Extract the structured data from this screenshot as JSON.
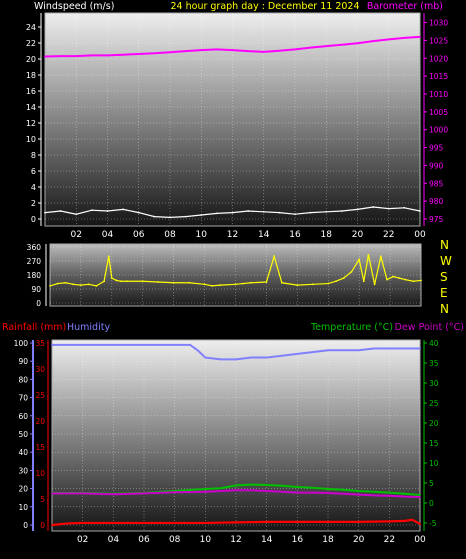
{
  "header": {
    "left_label": "Windspeed (m/s)",
    "title": "24 hour graph day : December 11 2024",
    "right_label": "Barometer (mb)"
  },
  "colors": {
    "background": "#000000",
    "windspeed": "#ffffff",
    "barometer": "#ff00ff",
    "direction": "#ffff00",
    "rainfall": "#ff0000",
    "humidity": "#8080ff",
    "temperature": "#00c000",
    "dewpoint": "#cc00cc",
    "grid": "#ffffff",
    "axis_left_wind": "#ffffff",
    "axis_right_baro": "#ff00ff",
    "axis_rain": "#ff0000",
    "axis_humidity": "#8080ff",
    "axis_temp": "#00c000"
  },
  "x_ticks": [
    "02",
    "04",
    "06",
    "08",
    "10",
    "12",
    "14",
    "16",
    "18",
    "20",
    "22",
    "00"
  ],
  "compass": [
    "N",
    "W",
    "S",
    "E",
    "N"
  ],
  "bottom_header": {
    "rain_label": "Rainfall (mm)",
    "humidity_label": "Humidity",
    "temp_label": "Temperature (°C)",
    "dew_label": "Dew Point (°C)"
  },
  "chart_data": [
    {
      "type": "line",
      "name": "wind-baro",
      "title": "24 hour graph day : December 11 2024",
      "xlabel": "",
      "ylabel": "Windspeed (m/s)",
      "y2label": "Barometer (mb)",
      "x_ticks": [
        "02",
        "04",
        "06",
        "08",
        "10",
        "12",
        "14",
        "16",
        "18",
        "20",
        "22",
        "00"
      ],
      "ylim": [
        0,
        25
      ],
      "y_ticks": [
        0,
        2,
        4,
        6,
        8,
        10,
        12,
        14,
        16,
        18,
        20,
        22,
        24
      ],
      "y2lim": [
        975,
        1031
      ],
      "y2_ticks": [
        975,
        980,
        985,
        990,
        995,
        1000,
        1005,
        1010,
        1015,
        1020,
        1025,
        1030
      ],
      "grid": true,
      "series": [
        {
          "name": "Windspeed (m/s)",
          "axis": "left",
          "x": [
            0.0,
            1.0,
            2.0,
            3.0,
            4.0,
            5.0,
            6.0,
            7.0,
            8.0,
            9.0,
            10.0,
            11.0,
            12.0,
            13.0,
            14.0,
            15.0,
            16.0,
            17.0,
            18.0,
            19.0,
            20.0,
            21.0,
            22.0,
            23.0,
            24.0
          ],
          "y": [
            0.8,
            1.0,
            0.6,
            1.1,
            1.0,
            1.2,
            0.8,
            0.3,
            0.2,
            0.3,
            0.5,
            0.7,
            0.8,
            1.0,
            0.9,
            0.8,
            0.6,
            0.8,
            0.9,
            1.0,
            1.2,
            1.5,
            1.3,
            1.4,
            1.0
          ]
        },
        {
          "name": "Barometer (mb)",
          "axis": "right",
          "x": [
            0.0,
            1.0,
            2.0,
            3.0,
            4.0,
            5.0,
            6.0,
            7.0,
            8.0,
            9.0,
            10.0,
            11.0,
            12.0,
            13.0,
            14.0,
            15.0,
            16.0,
            17.0,
            18.0,
            19.0,
            20.0,
            21.0,
            22.0,
            23.0,
            24.0
          ],
          "y": [
            1020.5,
            1020.6,
            1020.6,
            1020.8,
            1020.8,
            1021.0,
            1021.2,
            1021.4,
            1021.7,
            1022.0,
            1022.3,
            1022.5,
            1022.3,
            1022.0,
            1021.8,
            1022.1,
            1022.5,
            1023.0,
            1023.4,
            1023.8,
            1024.2,
            1024.8,
            1025.3,
            1025.7,
            1026.0
          ]
        }
      ]
    },
    {
      "type": "line",
      "name": "direction",
      "title": "",
      "xlabel": "",
      "ylabel": "",
      "ylim": [
        0,
        360
      ],
      "y_ticks": [
        0,
        90,
        180,
        270,
        360
      ],
      "y_tick_labels": [
        "0",
        "90",
        "180",
        "270",
        "360"
      ],
      "grid": true,
      "series": [
        {
          "name": "Direction",
          "x": [
            0.0,
            0.5,
            1.0,
            1.5,
            2.0,
            2.5,
            3.0,
            3.5,
            3.8,
            4.0,
            4.3,
            4.6,
            5.0,
            6.0,
            7.0,
            8.0,
            9.0,
            10.0,
            10.5,
            11.0,
            12.0,
            12.5,
            13.0,
            14.0,
            14.5,
            15.0,
            16.0,
            17.0,
            18.0,
            18.5,
            19.0,
            19.5,
            20.0,
            20.3,
            20.6,
            21.0,
            21.4,
            21.8,
            22.2,
            22.6,
            23.0,
            23.5,
            24.0
          ],
          "y": [
            110,
            125,
            130,
            120,
            115,
            120,
            110,
            140,
            300,
            160,
            145,
            140,
            140,
            140,
            135,
            130,
            130,
            120,
            110,
            115,
            120,
            125,
            130,
            135,
            300,
            130,
            115,
            120,
            125,
            140,
            160,
            200,
            280,
            140,
            310,
            120,
            300,
            150,
            170,
            160,
            150,
            140,
            145
          ]
        }
      ]
    },
    {
      "type": "line",
      "name": "rain-humidity-temp",
      "title": "",
      "xlabel": "",
      "ylabel": "Rainfall (mm) / Humidity",
      "y2label": "Temperature (°C) / Dew Point (°C)",
      "ylim": [
        0,
        100
      ],
      "y_ticks": [
        0,
        10,
        20,
        30,
        40,
        50,
        60,
        70,
        80,
        90,
        100
      ],
      "rain_ylim": [
        0,
        35
      ],
      "rain_ticks": [
        0,
        5,
        10,
        15,
        20,
        25,
        30,
        35
      ],
      "y2lim": [
        -5.5,
        40
      ],
      "y2_ticks": [
        -5,
        0,
        5,
        10,
        15,
        20,
        25,
        30,
        35,
        40
      ],
      "grid": true,
      "series": [
        {
          "name": "Rainfall (mm)",
          "axis": "rain",
          "x": [
            0.0,
            1.0,
            2.0,
            4.0,
            6.0,
            8.0,
            10.0,
            12.0,
            14.0,
            16.0,
            18.0,
            20.0,
            22.0,
            23.0,
            23.5,
            24.0
          ],
          "y": [
            0.0,
            0.3,
            0.4,
            0.4,
            0.4,
            0.4,
            0.4,
            0.5,
            0.6,
            0.6,
            0.6,
            0.6,
            0.7,
            0.8,
            1.0,
            0.2
          ]
        },
        {
          "name": "Humidity",
          "axis": "humidity",
          "x": [
            0.0,
            2.0,
            4.0,
            6.0,
            8.0,
            9.0,
            9.5,
            10.0,
            11.0,
            12.0,
            13.0,
            14.0,
            15.0,
            16.0,
            17.0,
            18.0,
            19.0,
            20.0,
            21.0,
            22.0,
            23.0,
            24.0
          ],
          "y": [
            99,
            99,
            99,
            99,
            99,
            99,
            96,
            92,
            91,
            91,
            92,
            92,
            93,
            94,
            95,
            96,
            96,
            96,
            97,
            97,
            97,
            97
          ]
        },
        {
          "name": "Temperature (°C)",
          "axis": "temp",
          "x": [
            0.0,
            2.0,
            4.0,
            6.0,
            8.0,
            10.0,
            11.0,
            12.0,
            13.0,
            14.0,
            15.0,
            16.0,
            17.0,
            18.0,
            19.0,
            20.0,
            21.0,
            22.0,
            23.0,
            24.0
          ],
          "y": [
            2.5,
            2.5,
            2.3,
            2.5,
            3.0,
            3.5,
            3.7,
            4.4,
            4.6,
            4.5,
            4.3,
            4.0,
            3.8,
            3.5,
            3.3,
            3.0,
            2.8,
            2.6,
            2.3,
            2.0
          ]
        },
        {
          "name": "Dew Point (°C)",
          "axis": "temp",
          "x": [
            0.0,
            2.0,
            4.0,
            6.0,
            8.0,
            10.0,
            11.0,
            12.0,
            13.0,
            14.0,
            15.0,
            16.0,
            17.0,
            18.0,
            19.0,
            20.0,
            21.0,
            22.0,
            23.0,
            24.0
          ],
          "y": [
            2.4,
            2.4,
            2.2,
            2.4,
            2.7,
            2.8,
            3.0,
            3.2,
            3.2,
            3.0,
            2.8,
            2.6,
            2.6,
            2.5,
            2.3,
            2.1,
            1.9,
            1.8,
            1.6,
            1.5
          ]
        }
      ]
    }
  ]
}
